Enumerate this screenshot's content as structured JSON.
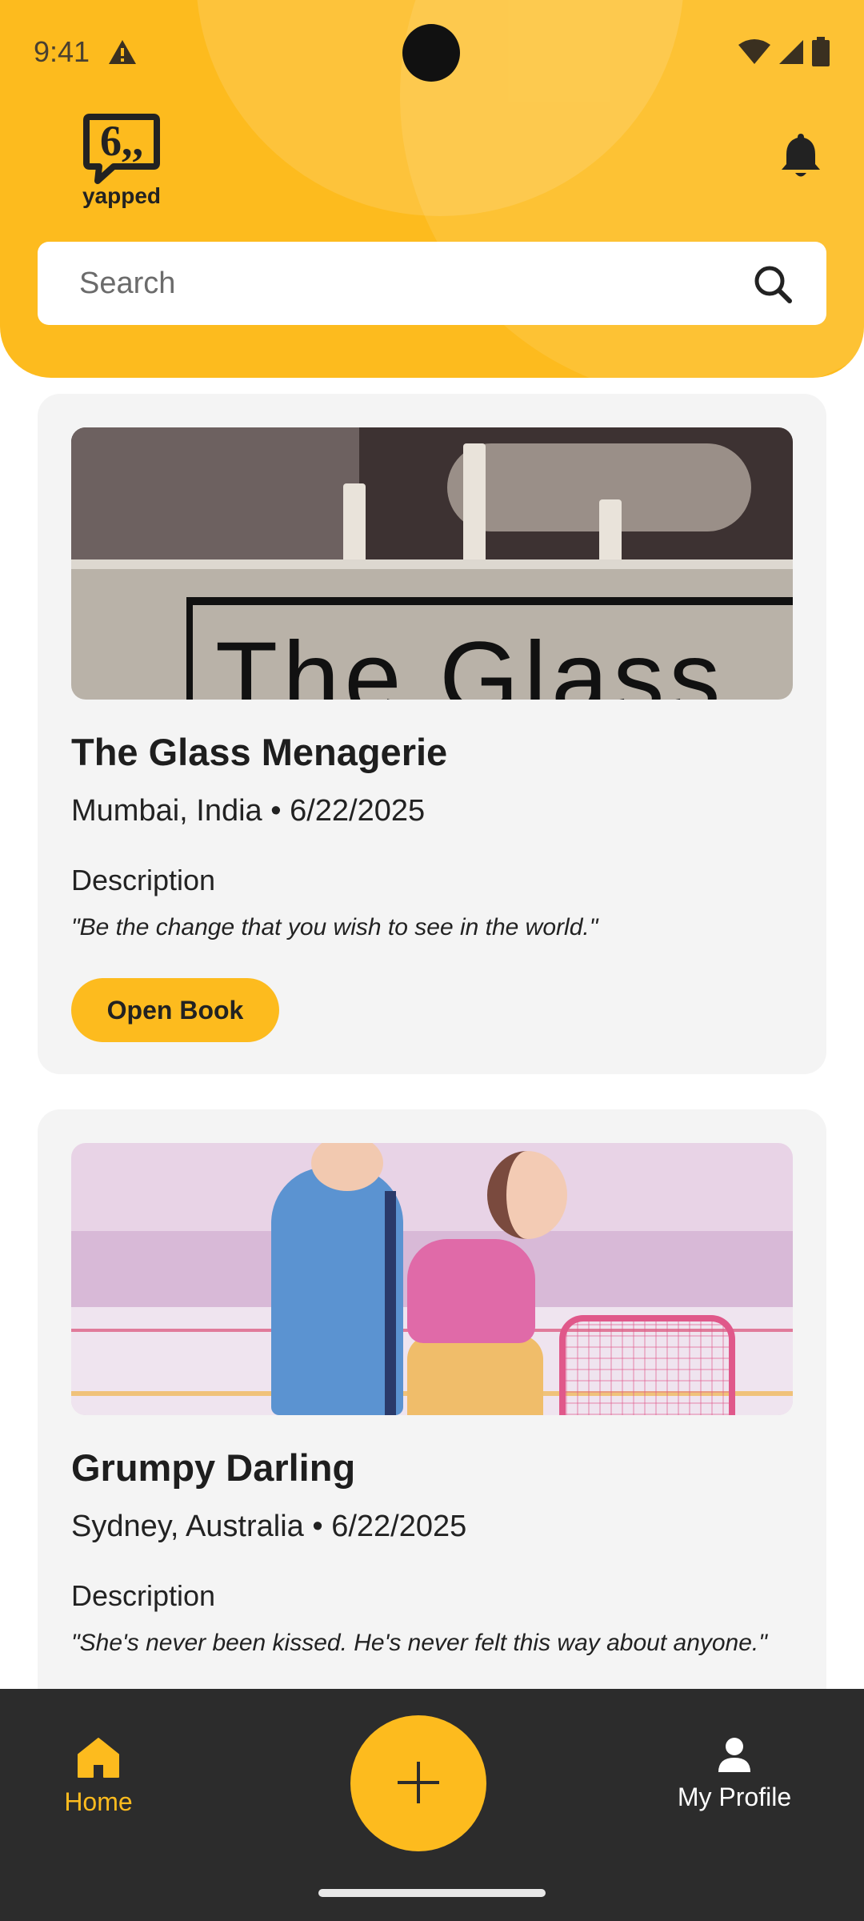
{
  "status_bar": {
    "time": "9:41",
    "icons": [
      "warning-icon",
      "wifi-icon",
      "cellular-icon",
      "battery-icon"
    ]
  },
  "header": {
    "logo_text": "yapped",
    "notification_icon": "bell-icon"
  },
  "search": {
    "placeholder": "Search",
    "value": "",
    "icon": "search-icon"
  },
  "books": [
    {
      "title": "The Glass Menagerie",
      "meta": "Mumbai, India • 6/22/2025",
      "description_label": "Description",
      "quote": "\"Be the change that you wish to see in the world.\"",
      "button_label": "Open Book",
      "cover_text": "The Glass"
    },
    {
      "title": "Grumpy Darling",
      "meta": "Sydney, Australia • 6/22/2025",
      "description_label": "Description",
      "quote": "\"She's never been kissed. He's never felt this way about anyone.\""
    }
  ],
  "bottom_nav": {
    "home_label": "Home",
    "add_icon": "plus-icon",
    "profile_label": "My Profile"
  },
  "colors": {
    "brand_yellow": "#fdbb1e",
    "nav_background": "#2c2c2c",
    "card_background": "#f4f4f4"
  }
}
